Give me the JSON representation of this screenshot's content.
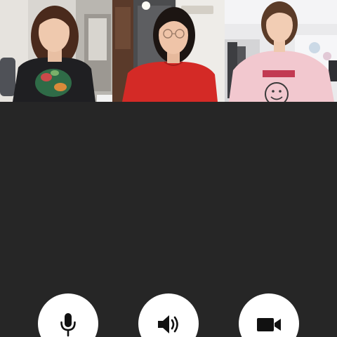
{
  "call": {
    "participants": [
      {
        "id": "participant-1",
        "shirt_color": "#1f1f22"
      },
      {
        "id": "participant-2",
        "shirt_color": "#d42a26"
      },
      {
        "id": "participant-3",
        "shirt_color": "#f2c8cf"
      }
    ]
  },
  "controls": {
    "buttons": [
      {
        "icon": "microphone-icon",
        "state": "on"
      },
      {
        "icon": "speaker-icon",
        "state": "on"
      },
      {
        "icon": "video-camera-icon",
        "state": "on"
      }
    ]
  },
  "theme": {
    "background": "#262626",
    "button_bg": "#ffffff",
    "icon_color": "#111111"
  }
}
